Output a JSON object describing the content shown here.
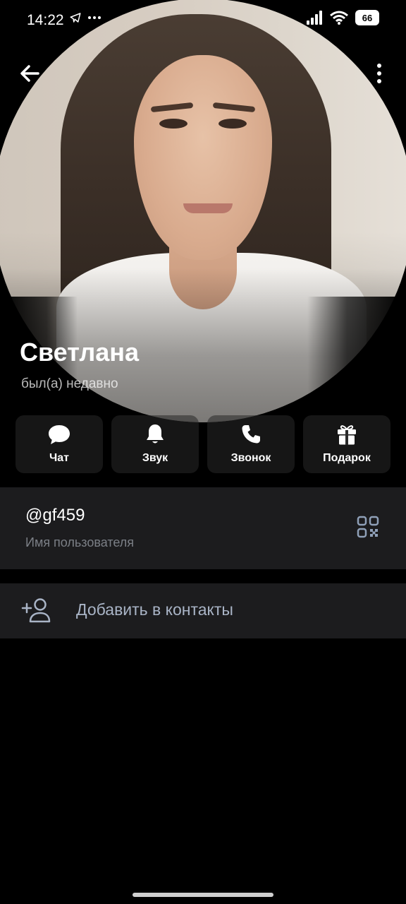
{
  "status_bar": {
    "time": "14:22",
    "battery": "66",
    "icons": [
      "telegram-send-icon",
      "more-dots-icon",
      "signal-icon",
      "wifi-icon",
      "battery-icon"
    ]
  },
  "header": {
    "back_icon": "arrow-left-icon",
    "menu_icon": "vertical-dots-icon"
  },
  "profile": {
    "name": "Светлана",
    "last_seen": "был(а) недавно"
  },
  "actions": [
    {
      "label": "Чат",
      "icon": "chat-bubble-icon"
    },
    {
      "label": "Звук",
      "icon": "bell-icon"
    },
    {
      "label": "Звонок",
      "icon": "phone-icon"
    },
    {
      "label": "Подарок",
      "icon": "gift-icon"
    }
  ],
  "username_card": {
    "value": "@gf459",
    "caption": "Имя пользователя",
    "qr_icon": "qr-code-icon"
  },
  "add_contact": {
    "label": "Добавить в контакты",
    "icon": "add-person-icon"
  },
  "colors": {
    "background": "#000000",
    "card": "#1c1c1e",
    "caption": "#7b7f86",
    "accent_text": "#a9b4c6"
  }
}
